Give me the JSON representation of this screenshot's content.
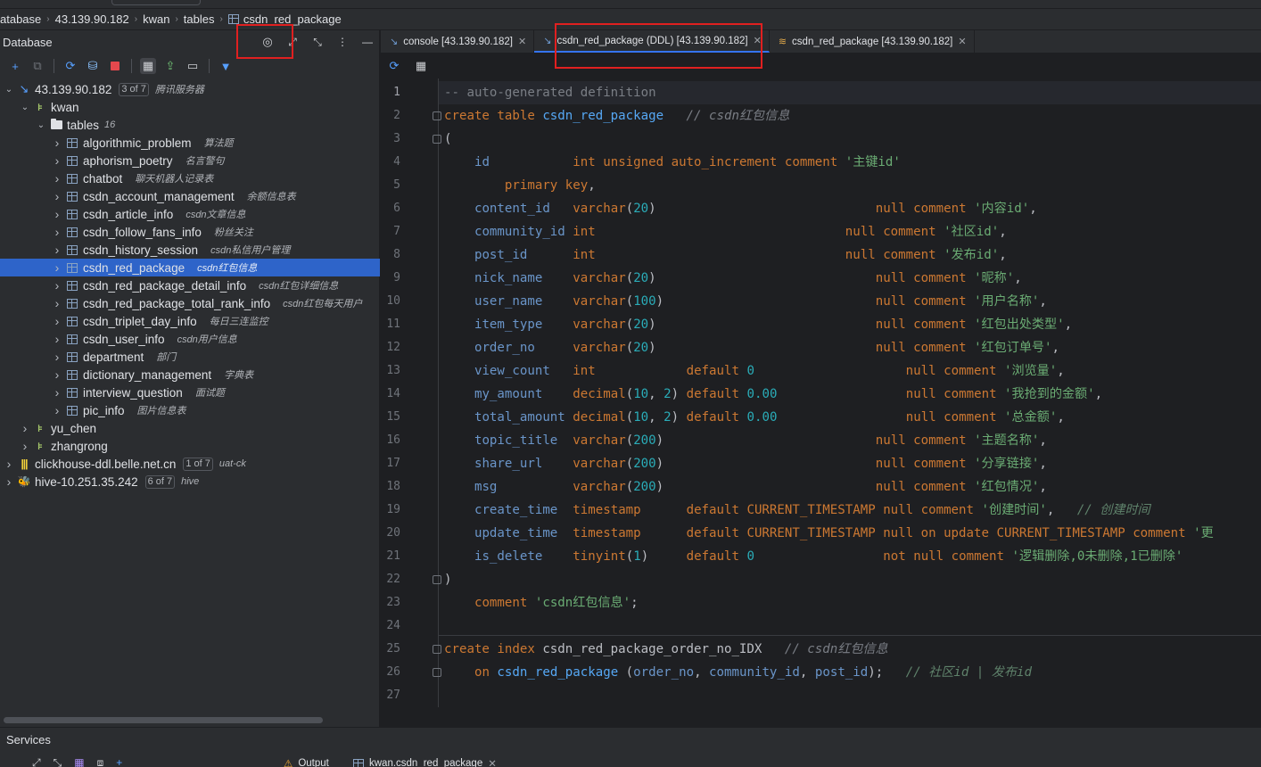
{
  "breadcrumb": {
    "items": [
      "atabase",
      "43.139.90.182",
      "kwan",
      "tables",
      "csdn_red_package"
    ]
  },
  "db_panel": {
    "title": "Database",
    "tree": [
      {
        "label": "43.139.90.182",
        "badge": "3 of 7",
        "comment": "腾讯服务器",
        "icon": "datasource-icon",
        "level": 0,
        "expanded": true
      },
      {
        "label": "kwan",
        "comment": "",
        "icon": "schema-icon",
        "level": 1,
        "expanded": true
      },
      {
        "label": "tables",
        "count": "16",
        "icon": "folder-icon",
        "level": 2,
        "expanded": true
      },
      {
        "label": "algorithmic_problem",
        "comment": "算法题",
        "icon": "table-icon",
        "level": 3
      },
      {
        "label": "aphorism_poetry",
        "comment": "名言警句",
        "icon": "table-icon",
        "level": 3
      },
      {
        "label": "chatbot",
        "comment": "聊天机器人记录表",
        "icon": "table-icon",
        "level": 3
      },
      {
        "label": "csdn_account_management",
        "comment": "余额信息表",
        "icon": "table-icon",
        "level": 3
      },
      {
        "label": "csdn_article_info",
        "comment": "csdn文章信息",
        "icon": "table-icon",
        "level": 3
      },
      {
        "label": "csdn_follow_fans_info",
        "comment": "粉丝关注",
        "icon": "table-icon",
        "level": 3
      },
      {
        "label": "csdn_history_session",
        "comment": "csdn私信用户管理",
        "icon": "table-icon",
        "level": 3
      },
      {
        "label": "csdn_red_package",
        "comment": "csdn红包信息",
        "icon": "table-icon",
        "level": 3,
        "selected": true
      },
      {
        "label": "csdn_red_package_detail_info",
        "comment": "csdn红包详细信息",
        "icon": "table-icon",
        "level": 3
      },
      {
        "label": "csdn_red_package_total_rank_info",
        "comment": "csdn红包每天用户",
        "icon": "table-icon",
        "level": 3
      },
      {
        "label": "csdn_triplet_day_info",
        "comment": "每日三连监控",
        "icon": "table-icon",
        "level": 3
      },
      {
        "label": "csdn_user_info",
        "comment": "csdn用户信息",
        "icon": "table-icon",
        "level": 3
      },
      {
        "label": "department",
        "comment": "部门",
        "icon": "table-icon",
        "level": 3
      },
      {
        "label": "dictionary_management",
        "comment": "字典表",
        "icon": "table-icon",
        "level": 3
      },
      {
        "label": "interview_question",
        "comment": "面试题",
        "icon": "table-icon",
        "level": 3
      },
      {
        "label": "pic_info",
        "comment": "图片信息表",
        "icon": "table-icon",
        "level": 3
      },
      {
        "label": "yu_chen",
        "comment": "",
        "icon": "schema-icon",
        "level": 1
      },
      {
        "label": "zhangrong",
        "comment": "",
        "icon": "schema-icon",
        "level": 1
      },
      {
        "label": "clickhouse-ddl.belle.net.cn",
        "badge": "1 of 7",
        "comment": "uat-ck",
        "icon": "clickhouse-icon",
        "level": 0
      },
      {
        "label": "hive-10.251.35.242",
        "badge": "6 of 7",
        "comment": "hive",
        "icon": "hive-icon",
        "level": 0
      }
    ]
  },
  "tabs": [
    {
      "label": "console [43.139.90.182]",
      "icon": "console-icon",
      "active": false
    },
    {
      "label": "csdn_red_package (DDL) [43.139.90.182]",
      "icon": "ddl-icon",
      "active": true
    },
    {
      "label": "csdn_red_package [43.139.90.182]",
      "icon": "table-data-icon",
      "active": false
    }
  ],
  "editor": {
    "line_numbers": [
      "1",
      "2",
      "3",
      "4",
      "5",
      "6",
      "7",
      "8",
      "9",
      "10",
      "11",
      "12",
      "13",
      "14",
      "15",
      "16",
      "17",
      "18",
      "19",
      "20",
      "21",
      "22",
      "23",
      "24",
      "25",
      "26",
      "27"
    ],
    "lines": [
      [
        [
          "-- auto-generated definition",
          "cmt0"
        ]
      ],
      [
        [
          "create table ",
          "kw"
        ],
        [
          "csdn_red_package",
          "fn"
        ],
        [
          "   // csdn红包信息",
          "cmt"
        ]
      ],
      [
        [
          "(",
          "plain"
        ]
      ],
      [
        [
          "    ",
          "plain"
        ],
        [
          "id",
          "col"
        ],
        [
          "           ",
          "plain"
        ],
        [
          "int unsigned auto_increment comment ",
          "kw"
        ],
        [
          "'主键id'",
          "str"
        ]
      ],
      [
        [
          "        ",
          "plain"
        ],
        [
          "primary key",
          "kw"
        ],
        [
          ",",
          "plain"
        ]
      ],
      [
        [
          "    ",
          "plain"
        ],
        [
          "content_id",
          "col"
        ],
        [
          "   ",
          "plain"
        ],
        [
          "varchar",
          "kw"
        ],
        [
          "(",
          "plain"
        ],
        [
          "20",
          "num"
        ],
        [
          ")",
          "plain"
        ],
        [
          "                             ",
          "plain"
        ],
        [
          "null comment ",
          "kw"
        ],
        [
          "'内容id'",
          "str"
        ],
        [
          ",",
          "plain"
        ]
      ],
      [
        [
          "    ",
          "plain"
        ],
        [
          "community_id",
          "col"
        ],
        [
          " ",
          "plain"
        ],
        [
          "int",
          "kw"
        ],
        [
          "                                 ",
          "plain"
        ],
        [
          "null comment ",
          "kw"
        ],
        [
          "'社区id'",
          "str"
        ],
        [
          ",",
          "plain"
        ]
      ],
      [
        [
          "    ",
          "plain"
        ],
        [
          "post_id",
          "col"
        ],
        [
          "      ",
          "plain"
        ],
        [
          "int",
          "kw"
        ],
        [
          "                                 ",
          "plain"
        ],
        [
          "null comment ",
          "kw"
        ],
        [
          "'发布id'",
          "str"
        ],
        [
          ",",
          "plain"
        ]
      ],
      [
        [
          "    ",
          "plain"
        ],
        [
          "nick_name",
          "col"
        ],
        [
          "    ",
          "plain"
        ],
        [
          "varchar",
          "kw"
        ],
        [
          "(",
          "plain"
        ],
        [
          "20",
          "num"
        ],
        [
          ")",
          "plain"
        ],
        [
          "                             ",
          "plain"
        ],
        [
          "null comment ",
          "kw"
        ],
        [
          "'昵称'",
          "str"
        ],
        [
          ",",
          "plain"
        ]
      ],
      [
        [
          "    ",
          "plain"
        ],
        [
          "user_name",
          "col"
        ],
        [
          "    ",
          "plain"
        ],
        [
          "varchar",
          "kw"
        ],
        [
          "(",
          "plain"
        ],
        [
          "100",
          "num"
        ],
        [
          ")",
          "plain"
        ],
        [
          "                            ",
          "plain"
        ],
        [
          "null comment ",
          "kw"
        ],
        [
          "'用户名称'",
          "str"
        ],
        [
          ",",
          "plain"
        ]
      ],
      [
        [
          "    ",
          "plain"
        ],
        [
          "item_type",
          "col"
        ],
        [
          "    ",
          "plain"
        ],
        [
          "varchar",
          "kw"
        ],
        [
          "(",
          "plain"
        ],
        [
          "20",
          "num"
        ],
        [
          ")",
          "plain"
        ],
        [
          "                             ",
          "plain"
        ],
        [
          "null comment ",
          "kw"
        ],
        [
          "'红包出处类型'",
          "str"
        ],
        [
          ",",
          "plain"
        ]
      ],
      [
        [
          "    ",
          "plain"
        ],
        [
          "order_no",
          "col"
        ],
        [
          "     ",
          "plain"
        ],
        [
          "varchar",
          "kw"
        ],
        [
          "(",
          "plain"
        ],
        [
          "20",
          "num"
        ],
        [
          ")",
          "plain"
        ],
        [
          "                             ",
          "plain"
        ],
        [
          "null comment ",
          "kw"
        ],
        [
          "'红包订单号'",
          "str"
        ],
        [
          ",",
          "plain"
        ]
      ],
      [
        [
          "    ",
          "plain"
        ],
        [
          "view_count",
          "col"
        ],
        [
          "   ",
          "plain"
        ],
        [
          "int",
          "kw"
        ],
        [
          "            ",
          "plain"
        ],
        [
          "default ",
          "kw"
        ],
        [
          "0",
          "num"
        ],
        [
          "                    ",
          "plain"
        ],
        [
          "null comment ",
          "kw"
        ],
        [
          "'浏览量'",
          "str"
        ],
        [
          ",",
          "plain"
        ]
      ],
      [
        [
          "    ",
          "plain"
        ],
        [
          "my_amount",
          "col"
        ],
        [
          "    ",
          "plain"
        ],
        [
          "decimal",
          "kw"
        ],
        [
          "(",
          "plain"
        ],
        [
          "10",
          "num"
        ],
        [
          ", ",
          "plain"
        ],
        [
          "2",
          "num"
        ],
        [
          ") ",
          "plain"
        ],
        [
          "default ",
          "kw"
        ],
        [
          "0.00",
          "num"
        ],
        [
          "                 ",
          "plain"
        ],
        [
          "null comment ",
          "kw"
        ],
        [
          "'我抢到的金额'",
          "str"
        ],
        [
          ",",
          "plain"
        ]
      ],
      [
        [
          "    ",
          "plain"
        ],
        [
          "total_amount",
          "col"
        ],
        [
          " ",
          "plain"
        ],
        [
          "decimal",
          "kw"
        ],
        [
          "(",
          "plain"
        ],
        [
          "10",
          "num"
        ],
        [
          ", ",
          "plain"
        ],
        [
          "2",
          "num"
        ],
        [
          ") ",
          "plain"
        ],
        [
          "default ",
          "kw"
        ],
        [
          "0.00",
          "num"
        ],
        [
          "                 ",
          "plain"
        ],
        [
          "null comment ",
          "kw"
        ],
        [
          "'总金额'",
          "str"
        ],
        [
          ",",
          "plain"
        ]
      ],
      [
        [
          "    ",
          "plain"
        ],
        [
          "topic_title",
          "col"
        ],
        [
          "  ",
          "plain"
        ],
        [
          "varchar",
          "kw"
        ],
        [
          "(",
          "plain"
        ],
        [
          "200",
          "num"
        ],
        [
          ")",
          "plain"
        ],
        [
          "                            ",
          "plain"
        ],
        [
          "null comment ",
          "kw"
        ],
        [
          "'主题名称'",
          "str"
        ],
        [
          ",",
          "plain"
        ]
      ],
      [
        [
          "    ",
          "plain"
        ],
        [
          "share_url",
          "col"
        ],
        [
          "    ",
          "plain"
        ],
        [
          "varchar",
          "kw"
        ],
        [
          "(",
          "plain"
        ],
        [
          "200",
          "num"
        ],
        [
          ")",
          "plain"
        ],
        [
          "                            ",
          "plain"
        ],
        [
          "null comment ",
          "kw"
        ],
        [
          "'分享链接'",
          "str"
        ],
        [
          ",",
          "plain"
        ]
      ],
      [
        [
          "    ",
          "plain"
        ],
        [
          "msg",
          "col"
        ],
        [
          "          ",
          "plain"
        ],
        [
          "varchar",
          "kw"
        ],
        [
          "(",
          "plain"
        ],
        [
          "200",
          "num"
        ],
        [
          ")",
          "plain"
        ],
        [
          "                            ",
          "plain"
        ],
        [
          "null comment ",
          "kw"
        ],
        [
          "'红包情况'",
          "str"
        ],
        [
          ",",
          "plain"
        ]
      ],
      [
        [
          "    ",
          "plain"
        ],
        [
          "create_time",
          "col"
        ],
        [
          "  ",
          "plain"
        ],
        [
          "timestamp",
          "kw"
        ],
        [
          "      ",
          "plain"
        ],
        [
          "default CURRENT_TIMESTAMP null comment ",
          "kw"
        ],
        [
          "'创建时间'",
          "str"
        ],
        [
          ",   ",
          "plain"
        ],
        [
          "// 创建时间",
          "cmt2"
        ]
      ],
      [
        [
          "    ",
          "plain"
        ],
        [
          "update_time",
          "col"
        ],
        [
          "  ",
          "plain"
        ],
        [
          "timestamp",
          "kw"
        ],
        [
          "      ",
          "plain"
        ],
        [
          "default CURRENT_TIMESTAMP null on update CURRENT_TIMESTAMP comment ",
          "kw"
        ],
        [
          "'更",
          "str"
        ]
      ],
      [
        [
          "    ",
          "plain"
        ],
        [
          "is_delete",
          "col"
        ],
        [
          "    ",
          "plain"
        ],
        [
          "tinyint",
          "kw"
        ],
        [
          "(",
          "plain"
        ],
        [
          "1",
          "num"
        ],
        [
          ")",
          "plain"
        ],
        [
          "     ",
          "plain"
        ],
        [
          "default ",
          "kw"
        ],
        [
          "0",
          "num"
        ],
        [
          "                 ",
          "plain"
        ],
        [
          "not null comment ",
          "kw"
        ],
        [
          "'逻辑删除,0未删除,1已删除'",
          "str"
        ]
      ],
      [
        [
          ")",
          "plain"
        ]
      ],
      [
        [
          "    ",
          "plain"
        ],
        [
          "comment ",
          "kw"
        ],
        [
          "'csdn红包信息'",
          "str"
        ],
        [
          ";",
          "plain"
        ]
      ],
      [
        [
          "",
          "plain"
        ]
      ],
      [
        [
          "create index ",
          "kw"
        ],
        [
          "csdn_red_package_order_no_IDX",
          "plain"
        ],
        [
          "   // csdn红包信息",
          "cmt"
        ]
      ],
      [
        [
          "    ",
          "plain"
        ],
        [
          "on ",
          "kw"
        ],
        [
          "csdn_red_package",
          "fn"
        ],
        [
          " (",
          "plain"
        ],
        [
          "order_no",
          "col"
        ],
        [
          ", ",
          "plain"
        ],
        [
          "community_id",
          "col"
        ],
        [
          ", ",
          "plain"
        ],
        [
          "post_id",
          "col"
        ],
        [
          ");   ",
          "plain"
        ],
        [
          "// 社区id | 发布id",
          "cmt2"
        ]
      ],
      [
        [
          "",
          "plain"
        ]
      ]
    ]
  },
  "services": {
    "title": "Services",
    "tabs": [
      {
        "label": "Output",
        "icon": "warning-icon"
      },
      {
        "label": "kwan.csdn_red_package",
        "icon": "table-data-icon"
      }
    ]
  },
  "colors": {
    "accent": "#3574f0",
    "selection": "#2e64c9",
    "highlight_box": "#e02020"
  }
}
